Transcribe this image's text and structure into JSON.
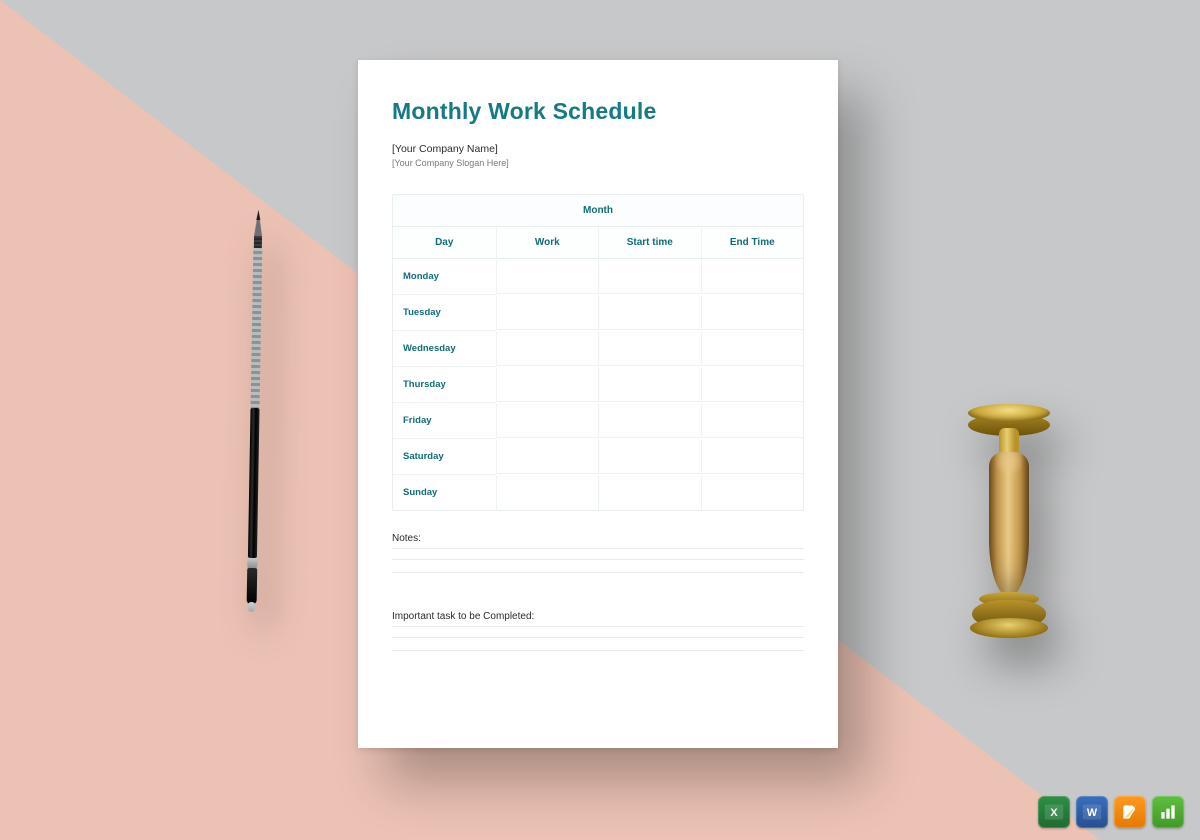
{
  "document": {
    "title": "Monthly Work Schedule",
    "company_name": "[Your Company Name]",
    "company_slogan": "[Your Company Slogan Here]",
    "table": {
      "month_label": "Month",
      "headers": {
        "day": "Day",
        "work": "Work",
        "start": "Start time",
        "end": "End Time"
      },
      "days": [
        "Monday",
        "Tuesday",
        "Wednesday",
        "Thursday",
        "Friday",
        "Saturday",
        "Sunday"
      ]
    },
    "notes_label": "Notes:",
    "tasks_label": "Important task to be Completed:"
  },
  "badges": {
    "excel": {
      "glyph": "X",
      "name": "excel-icon"
    },
    "word": {
      "glyph": "W",
      "name": "word-icon"
    },
    "pages": {
      "name": "pages-icon"
    },
    "numbers": {
      "name": "numbers-icon"
    }
  },
  "colors": {
    "accent": "#147a86",
    "grid": "#e9eef0"
  }
}
